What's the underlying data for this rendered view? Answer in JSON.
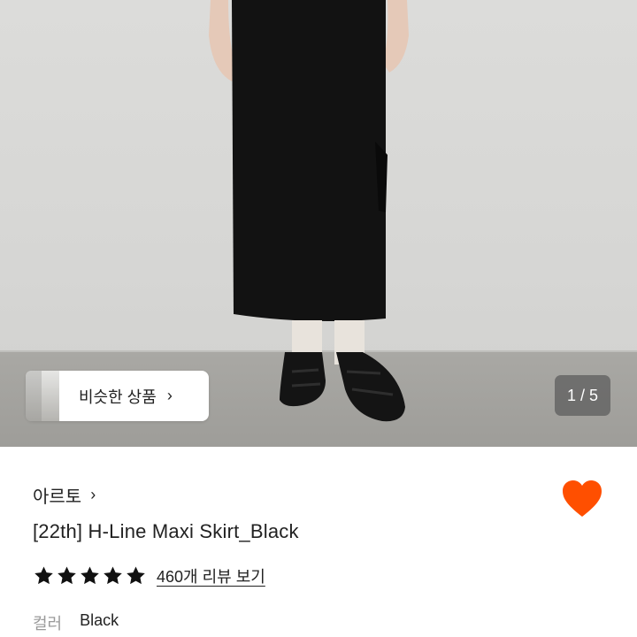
{
  "gallery": {
    "similar_label": "비슷한 상품",
    "counter": "1 / 5"
  },
  "product": {
    "brand": "아르토",
    "title": "[22th] H-Line Maxi Skirt_Black",
    "rating_stars": 5,
    "reviews_link": "460개 리뷰 보기",
    "option_label": "컬러",
    "option_value": "Black",
    "like_color": "#ff4f00"
  }
}
